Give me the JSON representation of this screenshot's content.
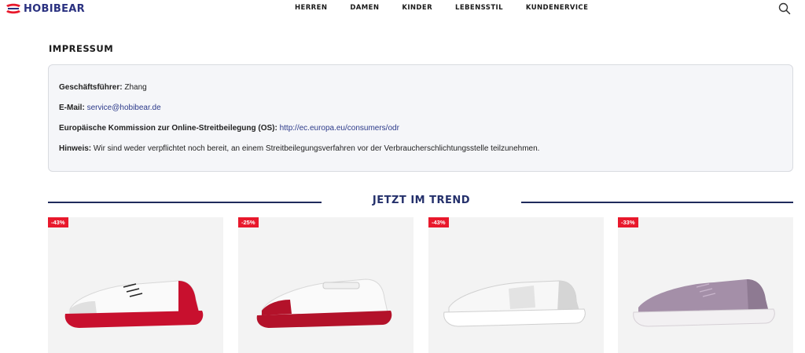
{
  "header": {
    "logo_text": "HOBIBEAR",
    "nav": [
      "HERREN",
      "DAMEN",
      "KINDER",
      "LEBENSSTIL",
      "KUNDENERVICE"
    ],
    "search_icon": "search-icon"
  },
  "page": {
    "title": "IMPRESSUM"
  },
  "impressum": {
    "manager_label": "Geschäftsführer:",
    "manager_value": "Zhang",
    "email_label": "E-Mail:",
    "email_value": "service@hobibear.de",
    "os_label": "Europäische Kommission zur Online-Streitbeilegung (OS):",
    "os_value": "http://ec.europa.eu/consumers/odr",
    "notice_label": "Hinweis:",
    "notice_value": "Wir sind weder verpflichtet noch bereit, an einem Streitbeilegungsverfahren vor der Verbraucherschlichtungsstelle teilzunehmen."
  },
  "trend": {
    "title": "JETZT IM TREND",
    "products": [
      {
        "badge": "-43%",
        "upper_color": "#ffffff",
        "accent_color": "#c8102e",
        "sole_color": "#c8102e"
      },
      {
        "badge": "-25%",
        "upper_color": "#ffffff",
        "accent_color": "#b3122a",
        "sole_color": "#b3122a"
      },
      {
        "badge": "-43%",
        "upper_color": "#f4f4f4",
        "accent_color": "#d5d5d5",
        "sole_color": "#ffffff"
      },
      {
        "badge": "-33%",
        "upper_color": "#a48fa8",
        "accent_color": "#8e7a92",
        "sole_color": "#f2f0f2"
      }
    ]
  },
  "colors": {
    "brand_navy": "#24306b",
    "badge_red": "#e8192c",
    "link_blue": "#2c3a8a"
  }
}
